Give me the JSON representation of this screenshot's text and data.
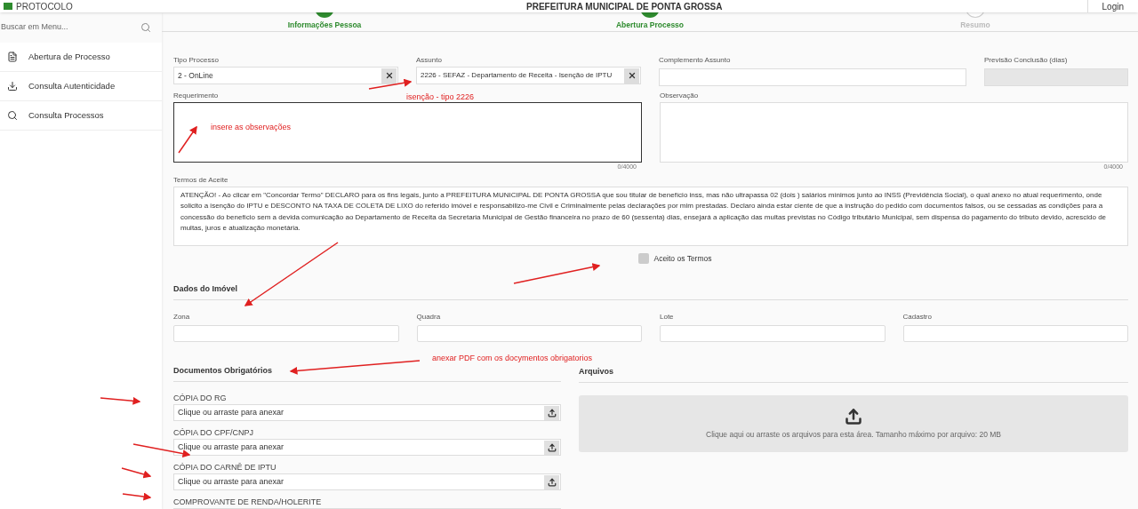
{
  "header": {
    "app_name": "PROTOCOLO",
    "title": "PREFEITURA MUNICIPAL DE PONTA GROSSA",
    "login": "Login"
  },
  "sidebar": {
    "search": {
      "placeholder": "Buscar em Menu..."
    },
    "items": [
      {
        "label": "Abertura de Processo",
        "kind": "file"
      },
      {
        "label": "Consulta Autenticidade",
        "kind": "download"
      },
      {
        "label": "Consulta Processos",
        "kind": "search"
      }
    ]
  },
  "steps": [
    {
      "label": "Informações Pessoa",
      "completed": true
    },
    {
      "label": "Abertura Processo",
      "completed": true
    },
    {
      "label": "Resumo",
      "completed": false
    }
  ],
  "form": {
    "tipo_processo": {
      "label": "Tipo Processo",
      "value": "2 - OnLine"
    },
    "assunto": {
      "label": "Assunto",
      "value": "2226 - SEFAZ - Departamento de Receita - Isenção de IPTU"
    },
    "complemento_assunto": {
      "label": "Complemento Assunto"
    },
    "previsao_conclusao": {
      "label": "Previsão Conclusão (dias)",
      "disabled": true
    },
    "requerimento": {
      "label": "Requerimento",
      "counter": "0/4000"
    },
    "observacao": {
      "label": "Observação",
      "counter": "0/4000"
    },
    "termos": {
      "label": "Termos de Aceite",
      "text": "ATENÇÃO! - Ao clicar em \"Concordar Termo\" DECLARO para os fins legais, junto a PREFEITURA MUNICIPAL DE PONTA GROSSA que sou titular de benefício inss, mas não ultrapassa 02 (dois ) salários mínimos junto ao INSS (Previdência Social), o qual anexo no atual requerimento, onde solicito a isenção do IPTU e DESCONTO NA TAXA DE COLETA DE LIXO do referido imóvel e responsabilizo-me Civil e Criminalmente pelas declarações por mim prestadas. Declaro ainda estar ciente de que a instrução do pedido com documentos falsos, ou se cessadas as condições para a concessão do benefício sem a devida comunicação ao Departamento de Receita da Secretaria Municipal de Gestão financeira no prazo de 60 (sessenta) dias, ensejará a aplicação das multas previstas no Código tributário Municipal, sem dispensa do pagamento do tributo devido, acrescido de multas, juros e atualização monetária."
    },
    "aceite": {
      "label": "Aceito os Termos",
      "checked": false
    }
  },
  "dados_imovel": {
    "title": "Dados do Imóvel",
    "fields": [
      "Zona",
      "Quadra",
      "Lote",
      "Cadastro"
    ]
  },
  "documentos": {
    "title": "Documentos Obrigatórios",
    "items": [
      {
        "label": "CÓPIA DO RG",
        "placeholder": "Clique ou arraste para anexar"
      },
      {
        "label": "CÓPIA DO CPF/CNPJ",
        "placeholder": "Clique ou arraste para anexar"
      },
      {
        "label": "CÓPIA DO CARNÊ DE IPTU",
        "placeholder": "Clique ou arraste para anexar"
      },
      {
        "label": "COMPROVANTE DE RENDA/HOLERITE"
      }
    ]
  },
  "arquivos": {
    "title": "Arquivos",
    "dropzone_text": "Clique aqui ou arraste os arquivos para esta área. Tamanho máximo por arquivo: 20 MB"
  },
  "annotations": [
    "isenção - tipo 2226",
    "insere as observações",
    "anexar PDF com os docymentos obrigatorios"
  ]
}
